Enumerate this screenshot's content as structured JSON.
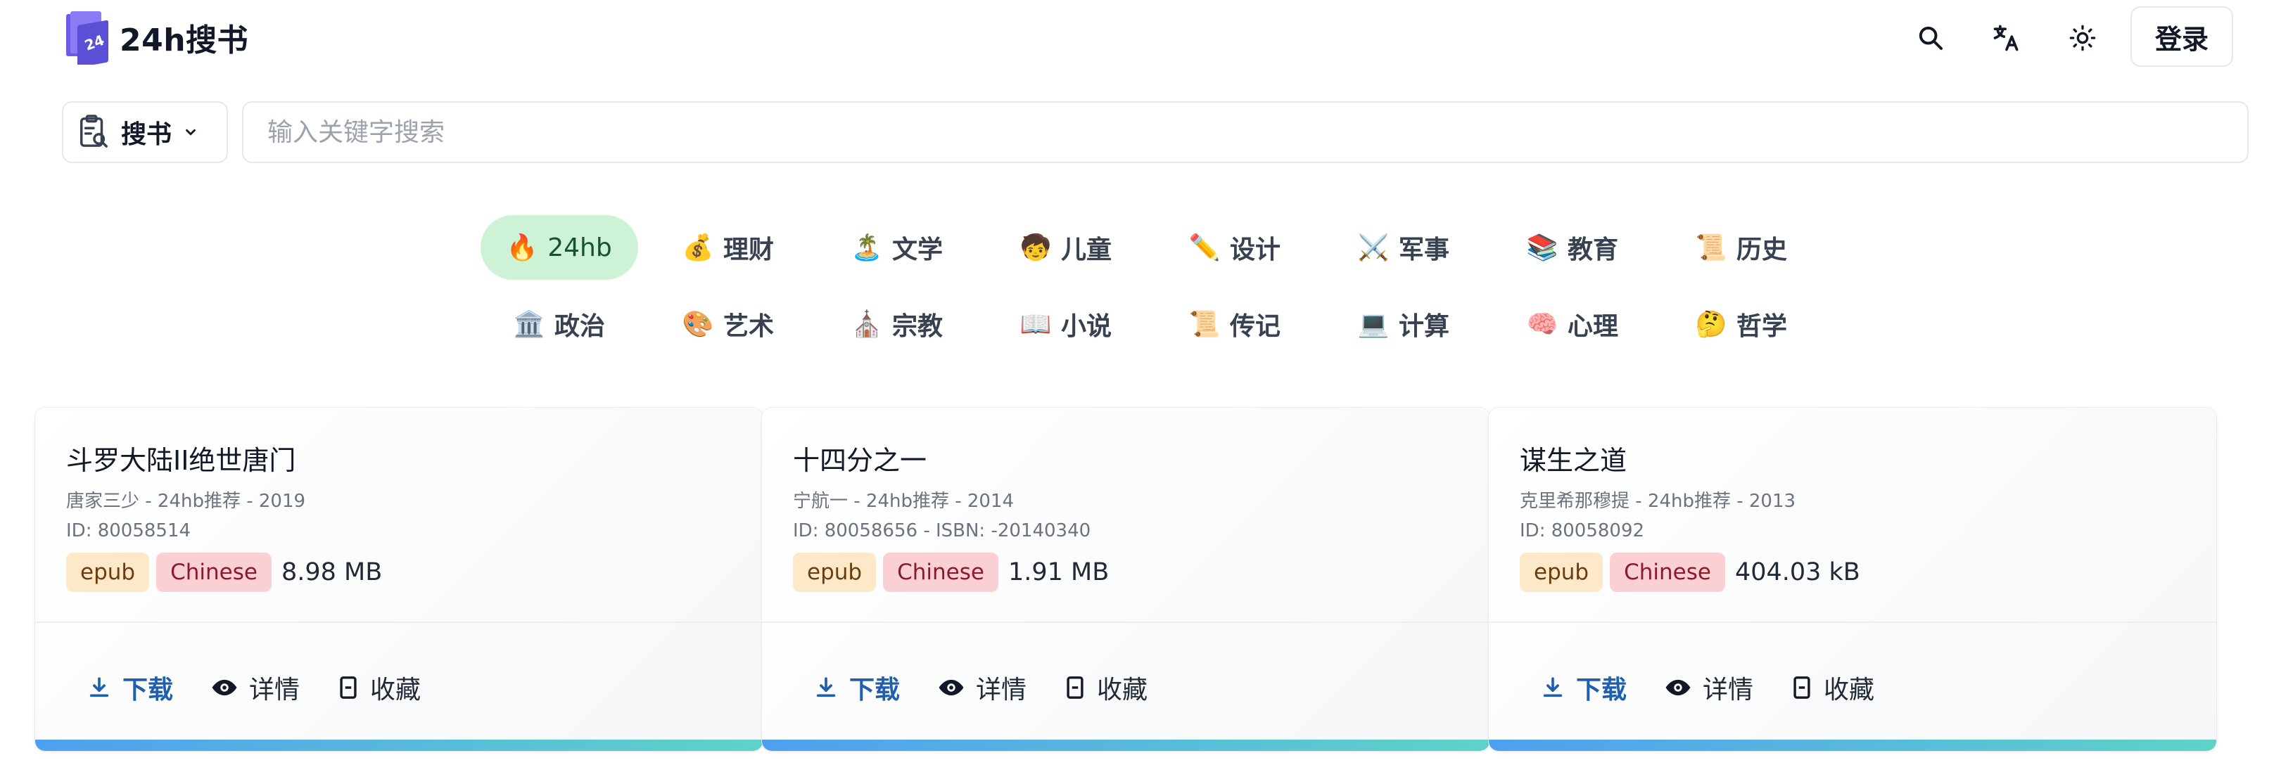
{
  "header": {
    "logo_text": "24h搜书",
    "logo_mark_text": "24",
    "icons": [
      "search-icon",
      "translate-icon",
      "sun-icon"
    ],
    "login_label": "登录"
  },
  "search": {
    "type_label": "搜书",
    "placeholder": "输入关键字搜索",
    "value": ""
  },
  "categories": [
    {
      "emoji": "🔥",
      "label": "24hb",
      "active": true
    },
    {
      "emoji": "💰",
      "label": "理财"
    },
    {
      "emoji": "🏝️",
      "label": "文学"
    },
    {
      "emoji": "🧒",
      "label": "儿童"
    },
    {
      "emoji": "✏️",
      "label": "设计"
    },
    {
      "emoji": "⚔️",
      "label": "军事"
    },
    {
      "emoji": "📚",
      "label": "教育"
    },
    {
      "emoji": "📜",
      "label": "历史"
    },
    {
      "emoji": "🏛️",
      "label": "政治"
    },
    {
      "emoji": "🎨",
      "label": "艺术"
    },
    {
      "emoji": "⛪",
      "label": "宗教"
    },
    {
      "emoji": "📖",
      "label": "小说"
    },
    {
      "emoji": "📜",
      "label": "传记"
    },
    {
      "emoji": "💻",
      "label": "计算"
    },
    {
      "emoji": "🧠",
      "label": "心理"
    },
    {
      "emoji": "🤔",
      "label": "哲学"
    }
  ],
  "cards": [
    {
      "title": "斗罗大陆II绝世唐门",
      "meta1": "唐家三少 - 24hb推荐 - 2019",
      "meta2": "ID: 80058514",
      "format": "epub",
      "language": "Chinese",
      "size": "8.98 MB",
      "download_label": "下载",
      "details_label": "详情",
      "favorite_label": "收藏"
    },
    {
      "title": "十四分之一",
      "meta1": "宁航一 - 24hb推荐 - 2014",
      "meta2": "ID: 80058656 - ISBN: -20140340",
      "format": "epub",
      "language": "Chinese",
      "size": "1.91 MB",
      "download_label": "下载",
      "details_label": "详情",
      "favorite_label": "收藏"
    },
    {
      "title": "谋生之道",
      "meta1": "克里希那穆提 - 24hb推荐 - 2013",
      "meta2": "ID: 80058092",
      "format": "epub",
      "language": "Chinese",
      "size": "404.03 kB",
      "download_label": "下载",
      "details_label": "详情",
      "favorite_label": "收藏"
    }
  ],
  "colors": {
    "active_category_bg": "#cdf2d5",
    "primary_action": "#1e5fae",
    "tag_format_bg": "#fde8c8",
    "tag_language_bg": "#fbd0d4",
    "card_bar_start": "#4f9ff0",
    "card_bar_end": "#5fd3c8"
  }
}
